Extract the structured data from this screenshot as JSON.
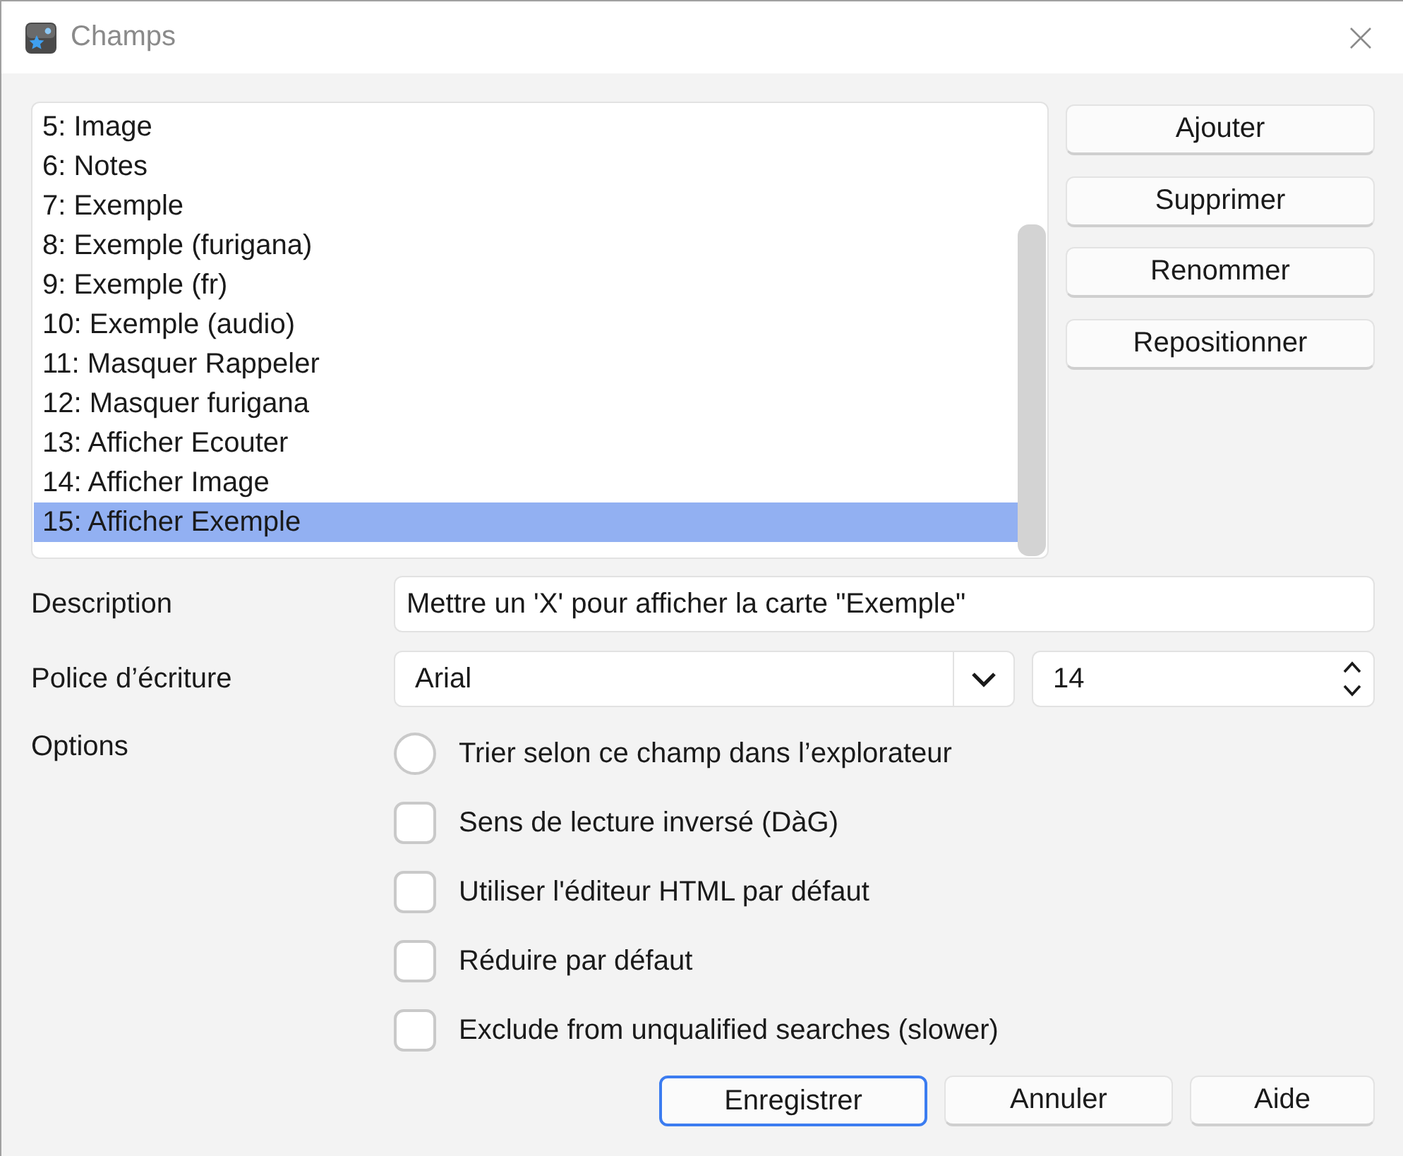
{
  "window": {
    "title": "Champs"
  },
  "fields_list": {
    "items": [
      {
        "label": "5: Image",
        "selected": false
      },
      {
        "label": "6: Notes",
        "selected": false
      },
      {
        "label": "7: Exemple",
        "selected": false
      },
      {
        "label": "8: Exemple (furigana)",
        "selected": false
      },
      {
        "label": "9: Exemple (fr)",
        "selected": false
      },
      {
        "label": "10: Exemple (audio)",
        "selected": false
      },
      {
        "label": "11: Masquer Rappeler",
        "selected": false
      },
      {
        "label": "12: Masquer furigana",
        "selected": false
      },
      {
        "label": "13: Afficher Ecouter",
        "selected": false
      },
      {
        "label": "14: Afficher Image",
        "selected": false
      },
      {
        "label": "15: Afficher Exemple",
        "selected": true
      }
    ]
  },
  "field_buttons": [
    "Ajouter",
    "Supprimer",
    "Renommer",
    "Repositionner"
  ],
  "description": {
    "label": "Description",
    "value": "Mettre un 'X' pour afficher la carte \"Exemple\""
  },
  "font": {
    "label": "Police d’écriture",
    "family": "Arial",
    "size": "14"
  },
  "options": {
    "label": "Options",
    "items": [
      {
        "kind": "radio",
        "label": "Trier selon ce champ dans l’explorateur",
        "checked": false
      },
      {
        "kind": "checkbox",
        "label": "Sens de lecture inversé (DàG)",
        "checked": false
      },
      {
        "kind": "checkbox",
        "label": "Utiliser l'éditeur HTML par défaut",
        "checked": false
      },
      {
        "kind": "checkbox",
        "label": "Réduire par défaut",
        "checked": false
      },
      {
        "kind": "checkbox",
        "label": "Exclude from unqualified searches (slower)",
        "checked": false
      }
    ]
  },
  "dialog_buttons": [
    {
      "label": "Enregistrer",
      "default": true
    },
    {
      "label": "Annuler",
      "default": false
    },
    {
      "label": "Aide",
      "default": false
    }
  ]
}
